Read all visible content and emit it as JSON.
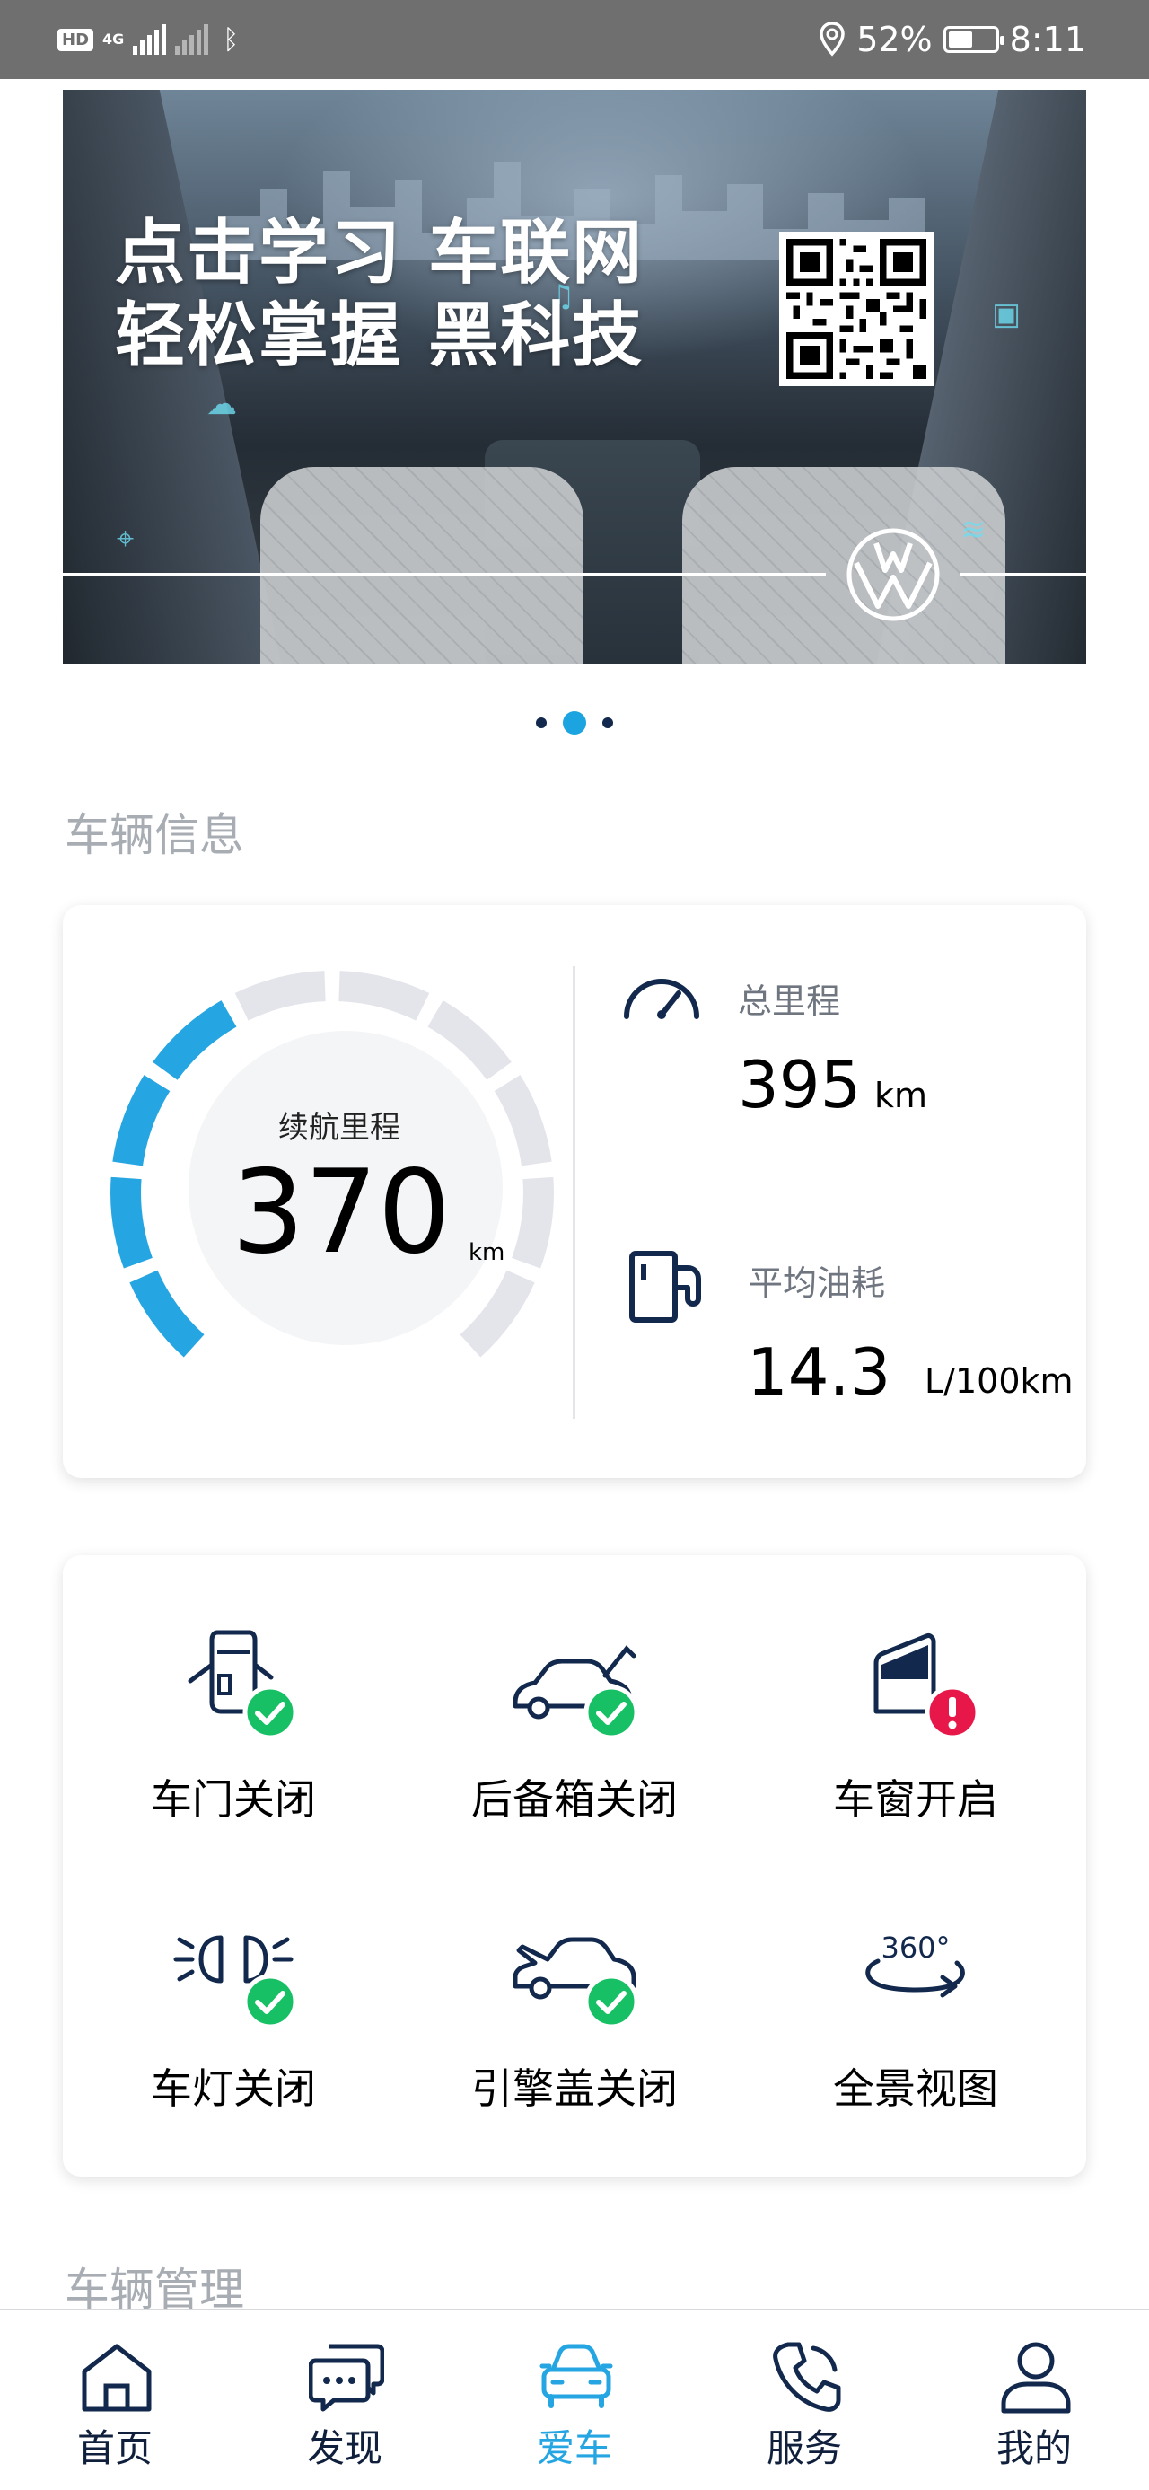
{
  "status_bar": {
    "network_hd": "HD",
    "network_type": "4G",
    "battery_percent": "52%",
    "battery_level": 0.52,
    "time": "8:11"
  },
  "banner": {
    "line1": "点击学习 车联网",
    "line2": "轻松掌握 黑科技",
    "carousel_total": 3,
    "carousel_active": 2
  },
  "vehicle_info": {
    "section_title": "车辆信息",
    "range": {
      "label": "续航里程",
      "value": "370",
      "unit": "km",
      "fill_fraction": 0.42
    },
    "odometer": {
      "label": "总里程",
      "value": "395",
      "unit": "km"
    },
    "fuel": {
      "label": "平均油耗",
      "value": "14.3",
      "unit": "L/100km"
    }
  },
  "vehicle_status": [
    {
      "label": "车门关闭",
      "icon": "car-door-icon",
      "badge": "ok"
    },
    {
      "label": "后备箱关闭",
      "icon": "trunk-icon",
      "badge": "ok"
    },
    {
      "label": "车窗开启",
      "icon": "car-window-icon",
      "badge": "warning"
    },
    {
      "label": "车灯关闭",
      "icon": "headlight-icon",
      "badge": "ok"
    },
    {
      "label": "引擎盖关闭",
      "icon": "hood-icon",
      "badge": "ok"
    },
    {
      "label": "全景视图",
      "icon": "360-view-icon",
      "badge": "none",
      "icon_text": "360°"
    }
  ],
  "vehicle_management": {
    "section_title": "车辆管理"
  },
  "bottom_nav": [
    {
      "label": "首页",
      "icon": "home-icon",
      "active": false
    },
    {
      "label": "发现",
      "icon": "chat-bubbles-icon",
      "active": false
    },
    {
      "label": "爱车",
      "icon": "car-icon",
      "active": true
    },
    {
      "label": "服务",
      "icon": "phone-icon",
      "active": false
    },
    {
      "label": "我的",
      "icon": "person-icon",
      "active": false
    }
  ],
  "colors": {
    "accent": "#25a6e2",
    "navy": "#12294d",
    "ok_green": "#17c064",
    "warning_red": "#e8174a",
    "gauge_inactive": "#e4e5ea",
    "section_title": "#a8adb4"
  }
}
